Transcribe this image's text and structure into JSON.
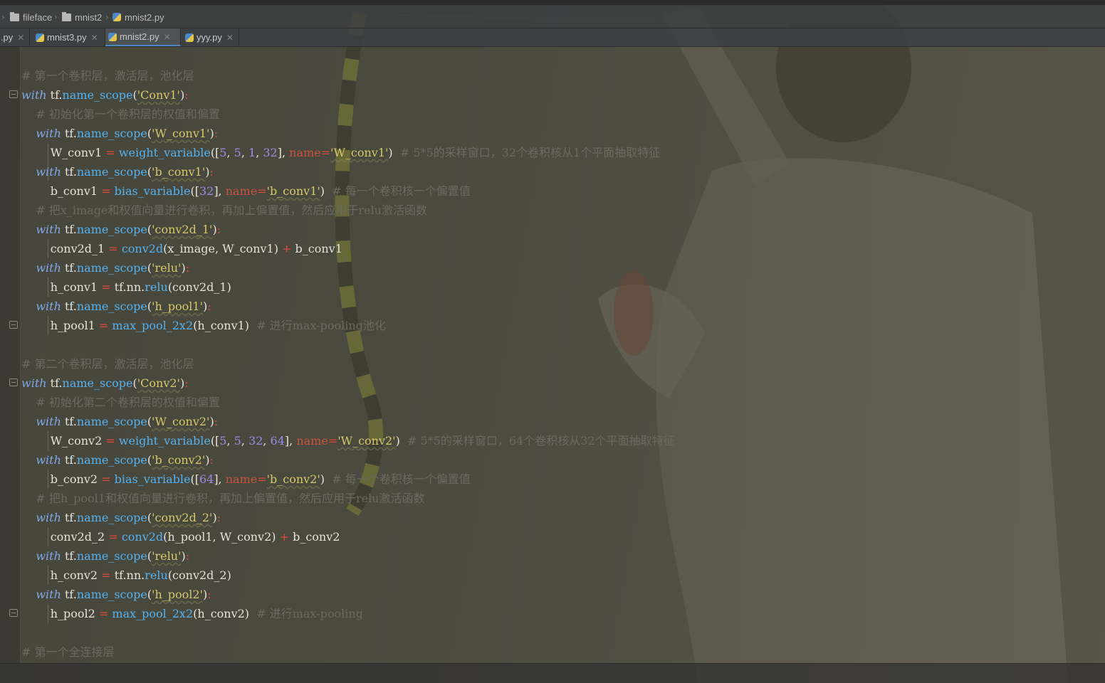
{
  "breadcrumb": [
    {
      "label": "fileface",
      "icon": "folder-icon"
    },
    {
      "label": "mnist2",
      "icon": "folder-icon"
    },
    {
      "label": "mnist2.py",
      "icon": "python-file-icon"
    }
  ],
  "tabs": [
    {
      "label": "l.py",
      "active": false
    },
    {
      "label": "mnist3.py",
      "active": false
    },
    {
      "label": "mnist2.py",
      "active": true
    },
    {
      "label": "yyy.py",
      "active": false
    }
  ],
  "colors": {
    "keyword": "#7fa8e6",
    "function": "#54b2f0",
    "string": "#d7c86a",
    "number": "#9a8ce6",
    "operator": "#e04b39",
    "comment": "#6b6a60",
    "active_tab_accent": "#4a88c7"
  },
  "code_lines": [
    [
      {
        "t": "# 第一个卷积层，激活层，池化层",
        "c": "cmt"
      }
    ],
    [
      {
        "t": "with",
        "c": "kw"
      },
      {
        "t": " tf."
      },
      {
        "t": "name_scope",
        "c": "fn"
      },
      {
        "t": "("
      },
      {
        "t": "'Conv1'",
        "c": "str"
      },
      {
        "t": ")"
      },
      {
        "t": ":",
        "c": "op"
      }
    ],
    [
      {
        "t": "    "
      },
      {
        "t": "# 初始化第一个卷积层的权值和偏置",
        "c": "cmt"
      }
    ],
    [
      {
        "t": "    "
      },
      {
        "t": "with",
        "c": "kw"
      },
      {
        "t": " tf."
      },
      {
        "t": "name_scope",
        "c": "fn"
      },
      {
        "t": "("
      },
      {
        "t": "'W_conv1'",
        "c": "str"
      },
      {
        "t": ")"
      },
      {
        "t": ":",
        "c": "op"
      }
    ],
    [
      {
        "t": "        W_conv1 "
      },
      {
        "t": "=",
        "c": "op"
      },
      {
        "t": " "
      },
      {
        "t": "weight_variable",
        "c": "fn"
      },
      {
        "t": "(["
      },
      {
        "t": "5",
        "c": "num"
      },
      {
        "t": ", "
      },
      {
        "t": "5",
        "c": "num"
      },
      {
        "t": ", "
      },
      {
        "t": "1",
        "c": "num"
      },
      {
        "t": ", "
      },
      {
        "t": "32",
        "c": "num"
      },
      {
        "t": "], "
      },
      {
        "t": "name",
        "c": "kwarg"
      },
      {
        "t": "=",
        "c": "op"
      },
      {
        "t": "'W_conv1'",
        "c": "str"
      },
      {
        "t": ")  "
      },
      {
        "t": "# 5*5的采样窗口，32个卷积核从1个平面抽取特征",
        "c": "cmt"
      }
    ],
    [
      {
        "t": "    "
      },
      {
        "t": "with",
        "c": "kw"
      },
      {
        "t": " tf."
      },
      {
        "t": "name_scope",
        "c": "fn"
      },
      {
        "t": "("
      },
      {
        "t": "'b_conv1'",
        "c": "str"
      },
      {
        "t": ")"
      },
      {
        "t": ":",
        "c": "op"
      }
    ],
    [
      {
        "t": "        b_conv1 "
      },
      {
        "t": "=",
        "c": "op"
      },
      {
        "t": " "
      },
      {
        "t": "bias_variable",
        "c": "fn"
      },
      {
        "t": "(["
      },
      {
        "t": "32",
        "c": "num"
      },
      {
        "t": "], "
      },
      {
        "t": "name",
        "c": "kwarg"
      },
      {
        "t": "=",
        "c": "op"
      },
      {
        "t": "'b_conv1'",
        "c": "str"
      },
      {
        "t": ")  "
      },
      {
        "t": "# 每一个卷积核一个偏置值",
        "c": "cmt"
      }
    ],
    [
      {
        "t": "    "
      },
      {
        "t": "# 把x_image和权值向量进行卷积，再加上偏置值，然后应用于relu激活函数",
        "c": "cmt"
      }
    ],
    [
      {
        "t": "    "
      },
      {
        "t": "with",
        "c": "kw"
      },
      {
        "t": " tf."
      },
      {
        "t": "name_scope",
        "c": "fn"
      },
      {
        "t": "("
      },
      {
        "t": "'conv2d_1'",
        "c": "str"
      },
      {
        "t": ")"
      },
      {
        "t": ":",
        "c": "op"
      }
    ],
    [
      {
        "t": "        conv2d_1 "
      },
      {
        "t": "=",
        "c": "op"
      },
      {
        "t": " "
      },
      {
        "t": "conv2d",
        "c": "fn"
      },
      {
        "t": "(x_image, W_conv1) "
      },
      {
        "t": "+",
        "c": "op"
      },
      {
        "t": " b_conv1"
      }
    ],
    [
      {
        "t": "    "
      },
      {
        "t": "with",
        "c": "kw"
      },
      {
        "t": " tf."
      },
      {
        "t": "name_scope",
        "c": "fn"
      },
      {
        "t": "("
      },
      {
        "t": "'relu'",
        "c": "str"
      },
      {
        "t": ")"
      },
      {
        "t": ":",
        "c": "op"
      }
    ],
    [
      {
        "t": "        h_conv1 "
      },
      {
        "t": "=",
        "c": "op"
      },
      {
        "t": " tf.nn."
      },
      {
        "t": "relu",
        "c": "fn"
      },
      {
        "t": "(conv2d_1)"
      }
    ],
    [
      {
        "t": "    "
      },
      {
        "t": "with",
        "c": "kw"
      },
      {
        "t": " tf."
      },
      {
        "t": "name_scope",
        "c": "fn"
      },
      {
        "t": "("
      },
      {
        "t": "'h_pool1'",
        "c": "str"
      },
      {
        "t": ")"
      },
      {
        "t": ":",
        "c": "op"
      }
    ],
    [
      {
        "t": "        h_pool1 "
      },
      {
        "t": "=",
        "c": "op"
      },
      {
        "t": " "
      },
      {
        "t": "max_pool_2x2",
        "c": "fn"
      },
      {
        "t": "(h_conv1)  "
      },
      {
        "t": "# 进行max-pooling池化",
        "c": "cmt"
      }
    ],
    [],
    [
      {
        "t": "# 第二个卷积层，激活层，池化层",
        "c": "cmt"
      }
    ],
    [
      {
        "t": "with",
        "c": "kw"
      },
      {
        "t": " tf."
      },
      {
        "t": "name_scope",
        "c": "fn"
      },
      {
        "t": "("
      },
      {
        "t": "'Conv2'",
        "c": "str"
      },
      {
        "t": ")"
      },
      {
        "t": ":",
        "c": "op"
      }
    ],
    [
      {
        "t": "    "
      },
      {
        "t": "# 初始化第二个卷积层的权值和偏置",
        "c": "cmt"
      }
    ],
    [
      {
        "t": "    "
      },
      {
        "t": "with",
        "c": "kw"
      },
      {
        "t": " tf."
      },
      {
        "t": "name_scope",
        "c": "fn"
      },
      {
        "t": "("
      },
      {
        "t": "'W_conv2'",
        "c": "str"
      },
      {
        "t": ")"
      },
      {
        "t": ":",
        "c": "op"
      }
    ],
    [
      {
        "t": "        W_conv2 "
      },
      {
        "t": "=",
        "c": "op"
      },
      {
        "t": " "
      },
      {
        "t": "weight_variable",
        "c": "fn"
      },
      {
        "t": "(["
      },
      {
        "t": "5",
        "c": "num"
      },
      {
        "t": ", "
      },
      {
        "t": "5",
        "c": "num"
      },
      {
        "t": ", "
      },
      {
        "t": "32",
        "c": "num"
      },
      {
        "t": ", "
      },
      {
        "t": "64",
        "c": "num"
      },
      {
        "t": "], "
      },
      {
        "t": "name",
        "c": "kwarg"
      },
      {
        "t": "=",
        "c": "op"
      },
      {
        "t": "'W_conv2'",
        "c": "str"
      },
      {
        "t": ")  "
      },
      {
        "t": "# 5*5的采样窗口，64个卷积核从32个平面抽取特征",
        "c": "cmt"
      }
    ],
    [
      {
        "t": "    "
      },
      {
        "t": "with",
        "c": "kw"
      },
      {
        "t": " tf."
      },
      {
        "t": "name_scope",
        "c": "fn"
      },
      {
        "t": "("
      },
      {
        "t": "'b_conv2'",
        "c": "str"
      },
      {
        "t": ")"
      },
      {
        "t": ":",
        "c": "op"
      }
    ],
    [
      {
        "t": "        b_conv2 "
      },
      {
        "t": "=",
        "c": "op"
      },
      {
        "t": " "
      },
      {
        "t": "bias_variable",
        "c": "fn"
      },
      {
        "t": "(["
      },
      {
        "t": "64",
        "c": "num"
      },
      {
        "t": "], "
      },
      {
        "t": "name",
        "c": "kwarg"
      },
      {
        "t": "=",
        "c": "op"
      },
      {
        "t": "'b_conv2'",
        "c": "str"
      },
      {
        "t": ")  "
      },
      {
        "t": "# 每一个卷积核一个偏置值",
        "c": "cmt"
      }
    ],
    [
      {
        "t": "    "
      },
      {
        "t": "# 把h_pool1和权值向量进行卷积，再加上偏置值，然后应用于relu激活函数",
        "c": "cmt"
      }
    ],
    [
      {
        "t": "    "
      },
      {
        "t": "with",
        "c": "kw"
      },
      {
        "t": " tf."
      },
      {
        "t": "name_scope",
        "c": "fn"
      },
      {
        "t": "("
      },
      {
        "t": "'conv2d_2'",
        "c": "str"
      },
      {
        "t": ")"
      },
      {
        "t": ":",
        "c": "op"
      }
    ],
    [
      {
        "t": "        conv2d_2 "
      },
      {
        "t": "=",
        "c": "op"
      },
      {
        "t": " "
      },
      {
        "t": "conv2d",
        "c": "fn"
      },
      {
        "t": "(h_pool1, W_conv2) "
      },
      {
        "t": "+",
        "c": "op"
      },
      {
        "t": " b_conv2"
      }
    ],
    [
      {
        "t": "    "
      },
      {
        "t": "with",
        "c": "kw"
      },
      {
        "t": " tf."
      },
      {
        "t": "name_scope",
        "c": "fn"
      },
      {
        "t": "("
      },
      {
        "t": "'relu'",
        "c": "str"
      },
      {
        "t": ")"
      },
      {
        "t": ":",
        "c": "op"
      }
    ],
    [
      {
        "t": "        h_conv2 "
      },
      {
        "t": "=",
        "c": "op"
      },
      {
        "t": " tf.nn."
      },
      {
        "t": "relu",
        "c": "fn"
      },
      {
        "t": "(conv2d_2)"
      }
    ],
    [
      {
        "t": "    "
      },
      {
        "t": "with",
        "c": "kw"
      },
      {
        "t": " tf."
      },
      {
        "t": "name_scope",
        "c": "fn"
      },
      {
        "t": "("
      },
      {
        "t": "'h_pool2'",
        "c": "str"
      },
      {
        "t": ")"
      },
      {
        "t": ":",
        "c": "op"
      }
    ],
    [
      {
        "t": "        h_pool2 "
      },
      {
        "t": "=",
        "c": "op"
      },
      {
        "t": " "
      },
      {
        "t": "max_pool_2x2",
        "c": "fn"
      },
      {
        "t": "(h_conv2)  "
      },
      {
        "t": "# 进行max-pooling",
        "c": "cmt"
      }
    ],
    [],
    [
      {
        "t": "# 第一个全连接层",
        "c": "cmt"
      }
    ]
  ]
}
